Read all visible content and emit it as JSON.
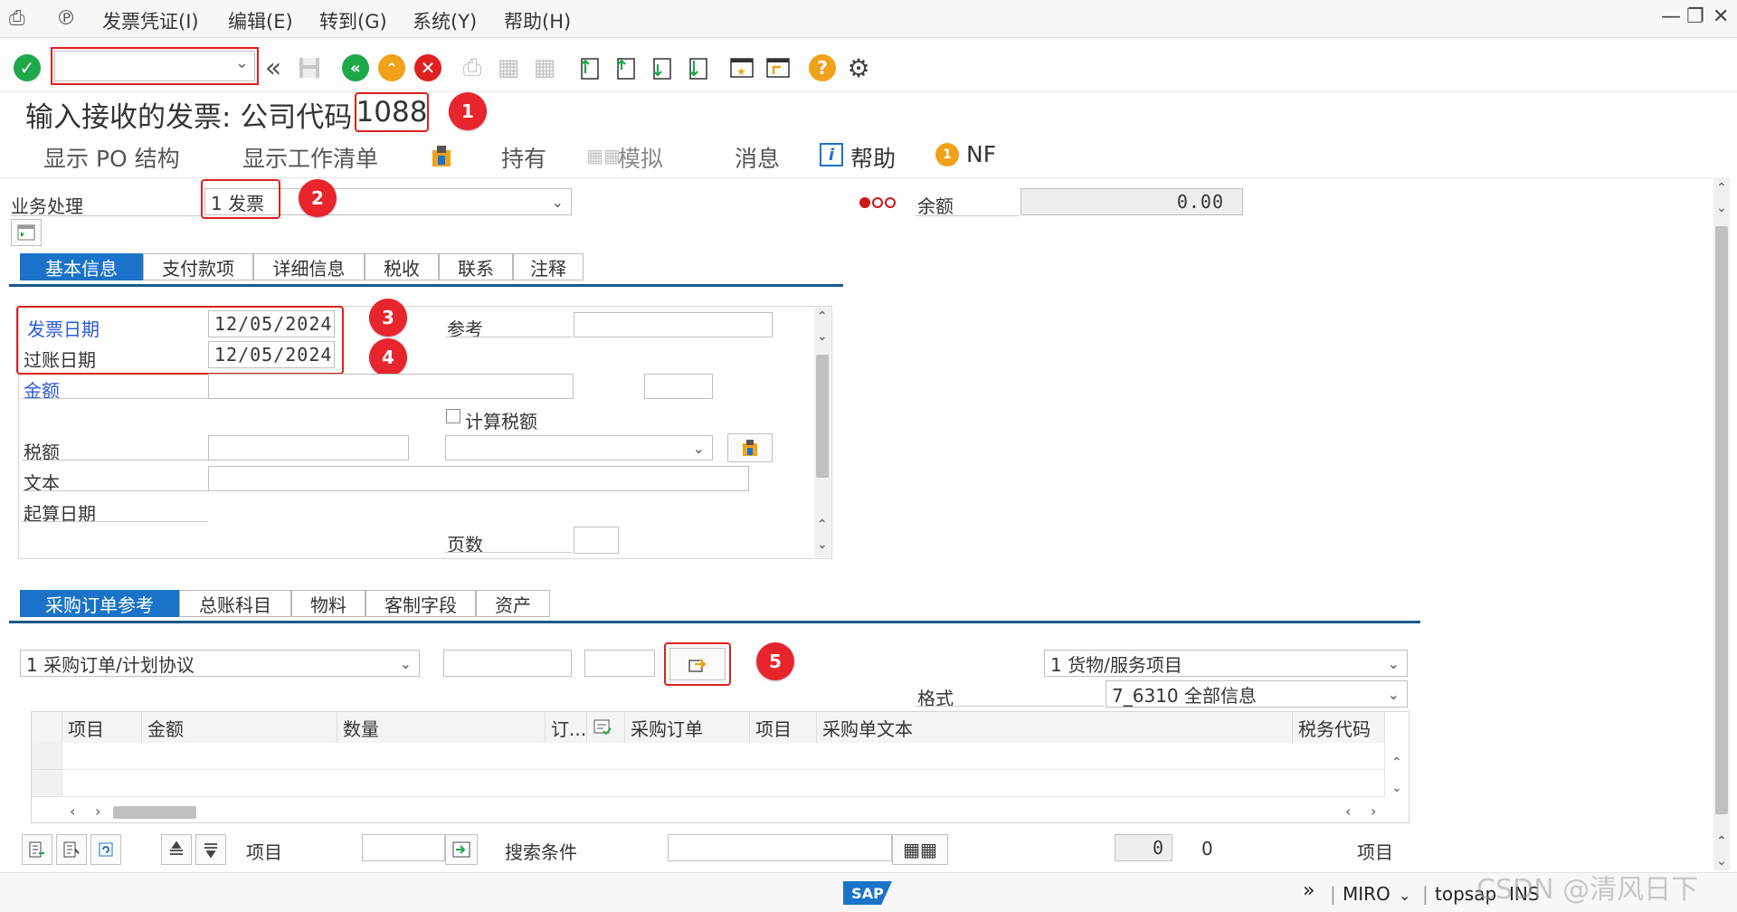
{
  "menu": {
    "items": [
      "发票凭证(I)",
      "编辑(E)",
      "转到(G)",
      "系统(Y)",
      "帮助(H)"
    ]
  },
  "page": {
    "title": "输入接收的发票: 公司代码",
    "company_code": "1088"
  },
  "app_toolbar": {
    "show_po_structure": "显示 PO 结构",
    "show_worklist": "显示工作清单",
    "hold": "持有",
    "simulate": "模拟",
    "messages": "消息",
    "help": "帮助",
    "nf": "NF"
  },
  "header": {
    "transaction_label": "业务处理",
    "transaction_value": "1 发票",
    "balance_label": "余额",
    "balance_value": "0.00"
  },
  "header_tabs": [
    "基本信息",
    "支付款项",
    "详细信息",
    "税收",
    "联系",
    "注释"
  ],
  "basic": {
    "invoice_date_label": "发票日期",
    "invoice_date": "12/05/2024",
    "posting_date_label": "过账日期",
    "posting_date": "12/05/2024",
    "reference_label": "参考",
    "amount_label": "金额",
    "calc_tax_label": "计算税额",
    "tax_label": "税额",
    "text_label": "文本",
    "baseline_date_label": "起算日期",
    "pages_label": "页数"
  },
  "po_tabs": [
    "采购订单参考",
    "总账科目",
    "物料",
    "客制字段",
    "资产"
  ],
  "po_ref": {
    "ref_type": "1 采购订单/计划协议",
    "item_type": "1 货物/服务项目",
    "layout_label": "格式",
    "layout_value": "7_6310 全部信息"
  },
  "table": {
    "columns": [
      "项目",
      "金额",
      "数量",
      "订...",
      "",
      "采购订单",
      "项目",
      "采购单文本",
      "税务代码"
    ]
  },
  "bottom": {
    "item_label": "项目",
    "search_label": "搜索条件",
    "count_a": "0",
    "count_b": "0",
    "items_label": "项目"
  },
  "status": {
    "transaction": "MIRO",
    "system": "topsap",
    "mode": "INS",
    "watermark": "CSDN @清风日下"
  },
  "markers": [
    "1",
    "2",
    "3",
    "4",
    "5"
  ],
  "colors": {
    "accent": "#1a73c8",
    "marker": "#e8242c",
    "ok": "#1ea84a"
  }
}
